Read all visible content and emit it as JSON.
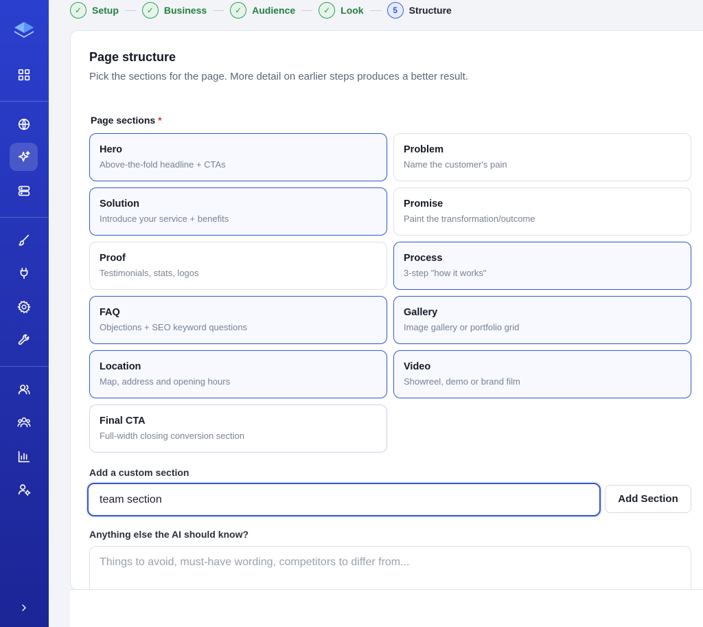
{
  "stepper": {
    "steps": [
      {
        "label": "Setup",
        "status": "done"
      },
      {
        "label": "Business",
        "status": "done"
      },
      {
        "label": "Audience",
        "status": "done"
      },
      {
        "label": "Look",
        "status": "done"
      },
      {
        "label": "Structure",
        "status": "current",
        "number": "5"
      }
    ]
  },
  "page": {
    "title": "Page structure",
    "subtitle": "Pick the sections for the page. More detail on earlier steps produces a better result.",
    "sections_label": "Page sections",
    "required_mark": "*"
  },
  "sections": [
    {
      "name": "Hero",
      "desc": "Above-the-fold headline + CTAs",
      "selected": true
    },
    {
      "name": "Problem",
      "desc": "Name the customer's pain",
      "selected": false
    },
    {
      "name": "Solution",
      "desc": "Introduce your service + benefits",
      "selected": true
    },
    {
      "name": "Promise",
      "desc": "Paint the transformation/outcome",
      "selected": false
    },
    {
      "name": "Proof",
      "desc": "Testimonials, stats, logos",
      "selected": false
    },
    {
      "name": "Process",
      "desc": "3-step \"how it works\"",
      "selected": true
    },
    {
      "name": "FAQ",
      "desc": "Objections + SEO keyword questions",
      "selected": true
    },
    {
      "name": "Gallery",
      "desc": "Image gallery or portfolio grid",
      "selected": true
    },
    {
      "name": "Location",
      "desc": "Map, address and opening hours",
      "selected": true
    },
    {
      "name": "Video",
      "desc": "Showreel, demo or brand film",
      "selected": true
    },
    {
      "name": "Final CTA",
      "desc": "Full-width closing conversion section",
      "selected": false
    }
  ],
  "custom": {
    "label": "Add a custom section",
    "value": "team section",
    "button": "Add Section"
  },
  "ai": {
    "label": "Anything else the AI should know?",
    "placeholder": "Things to avoid, must-have wording, competitors to differ from..."
  },
  "sidebar": {
    "icons": [
      "layers-logo-icon",
      "grid-icon",
      "globe-icon",
      "sparkle-icon",
      "server-icon",
      "brush-icon",
      "plug-icon",
      "gear-icon",
      "wrench-icon",
      "user-icon",
      "users-icon",
      "bar-chart-icon",
      "user-settings-icon",
      "chevron-right-icon"
    ],
    "active": "sparkle-icon"
  },
  "colors": {
    "sidebar_top": "#2b3fcf",
    "sidebar_bottom": "#1c2596",
    "done_green": "#2e9a57",
    "accent_blue": "#3a5fd6"
  }
}
